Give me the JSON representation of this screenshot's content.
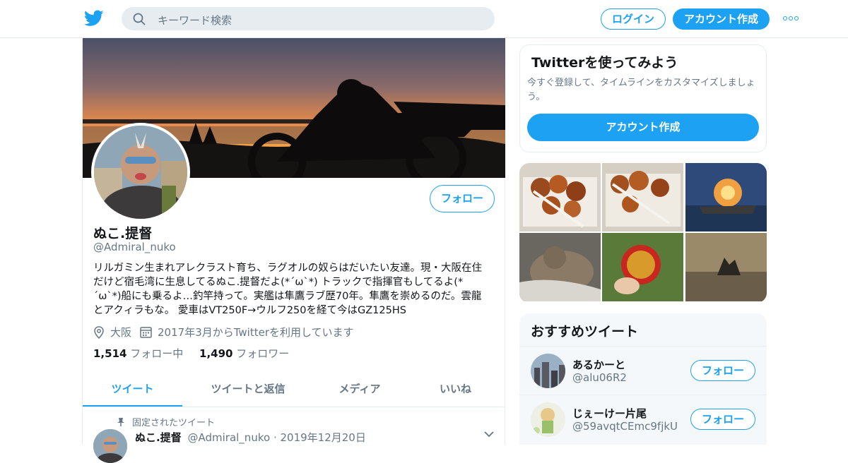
{
  "header": {
    "search_placeholder": "キーワード検索",
    "login_label": "ログイン",
    "signup_label": "アカウント作成",
    "accent_color": "#1da1f2"
  },
  "profile": {
    "name": "ぬこ.提督",
    "handle": "@Admiral_nuko",
    "follow_label": "フォロー",
    "bio": "リルガミン生まれアレクラスト育ち、ラグオルの奴らはだいたい友達。現・大阪在住だけど宿毛湾に生息してるぬこ.提督だよ(*´ω`*) トラックで指揮官もしてるよ(*´ω`*)船にも乗るよ…釣竿持って。実艦は隼鷹ラブ歴70年。隼鷹を崇めるのだ。雲龍とアクィラもな。 愛車はVT250F→ウルフ250を経て今はGZ125HS",
    "location": "大阪",
    "joined": "2017年3月からTwitterを利用しています",
    "following_count": "1,514",
    "following_label": "フォロー中",
    "followers_count": "1,490",
    "followers_label": "フォロワー"
  },
  "tabs": [
    {
      "label": "ツイート",
      "active": true
    },
    {
      "label": "ツイートと返信",
      "active": false
    },
    {
      "label": "メディア",
      "active": false
    },
    {
      "label": "いいね",
      "active": false
    }
  ],
  "pinned_tweet": {
    "pinned_label": "固定されたツイート",
    "name": "ぬこ.提督",
    "handle": "@Admiral_nuko",
    "separator": "·",
    "date": "2019年12月20日"
  },
  "signup_card": {
    "title": "Twitterを使ってみよう",
    "description": "今すぐ登録して、タイムラインをカスタマイズしましょう。",
    "button_label": "アカウント作成"
  },
  "recommended": {
    "title": "おすすめツイート",
    "accounts": [
      {
        "name": "あるかーと",
        "handle": "@alu06R2",
        "follow_label": "フォロー"
      },
      {
        "name": "じぇーけー片尾",
        "handle": "@59avqtCEmc9fjkU",
        "follow_label": "フォロー"
      }
    ]
  },
  "icons": [
    "twitter-bird-icon",
    "search-icon",
    "more-icon",
    "location-icon",
    "calendar-icon",
    "pin-icon",
    "chevron-down-icon"
  ]
}
